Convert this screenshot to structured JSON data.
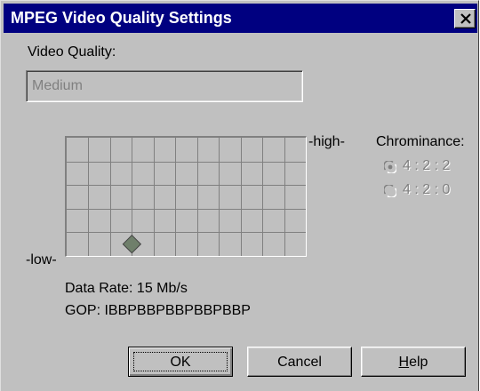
{
  "window": {
    "title": "MPEG Video Quality Settings"
  },
  "quality": {
    "label": "Video Quality:",
    "value": "Medium"
  },
  "graph": {
    "high_label": "-high-",
    "low_label": "-low-",
    "rows": 5,
    "columns": 11,
    "marker_column": 3,
    "marker_row": 5
  },
  "chrominance": {
    "label": "Chrominance:",
    "options": [
      {
        "label": "4 : 2 : 2",
        "selected": true,
        "enabled": false
      },
      {
        "label": "4 : 2 : 0",
        "selected": false,
        "enabled": false
      }
    ]
  },
  "info": {
    "data_rate": "Data Rate:  15 Mb/s",
    "gop": "GOP:  IBBPBBPBBPBBPBBP"
  },
  "buttons": {
    "ok": "OK",
    "cancel": "Cancel",
    "help_first": "H",
    "help_rest": "elp"
  },
  "colors": {
    "face": "#c0c0c0",
    "title_bar": "#000080",
    "marker": "#6f7f6b"
  }
}
